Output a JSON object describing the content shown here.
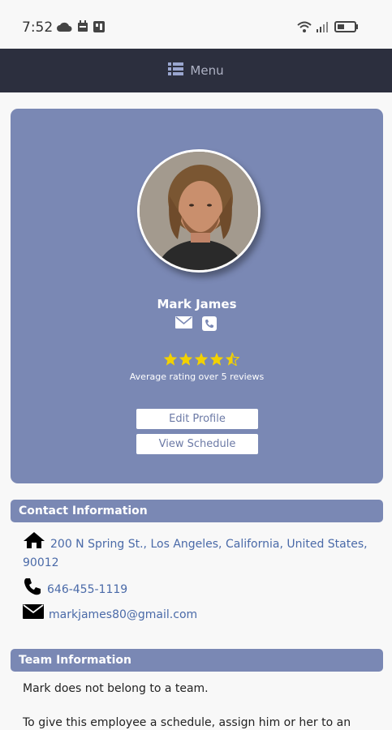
{
  "status_bar": {
    "time": "7:52",
    "left_icons": [
      "cloud-icon",
      "calendar-icon",
      "app-icon"
    ],
    "right_icons": [
      "wifi-icon",
      "signal-icon",
      "battery-icon"
    ]
  },
  "navbar": {
    "menu_icon": "list-icon",
    "menu_label": "Menu"
  },
  "profile": {
    "name": "Mark James",
    "rating": 4.5,
    "rating_text": "Average rating over 5 reviews",
    "edit_profile_label": "Edit Profile",
    "view_schedule_label": "View Schedule",
    "card_color": "#7a88b4",
    "star_color": "#f2d100"
  },
  "contact_info": {
    "header": "Contact Information",
    "address": "200 N Spring St., Los Angeles, California, United States,",
    "address_zip": "90012",
    "phone": "646-455-1119",
    "email": "markjames80@gmail.com"
  },
  "team_info": {
    "header": "Team Information",
    "no_team_text": "Mark does not belong to a team.",
    "schedule_hint": "To give this employee a schedule, assign him or her to an"
  }
}
